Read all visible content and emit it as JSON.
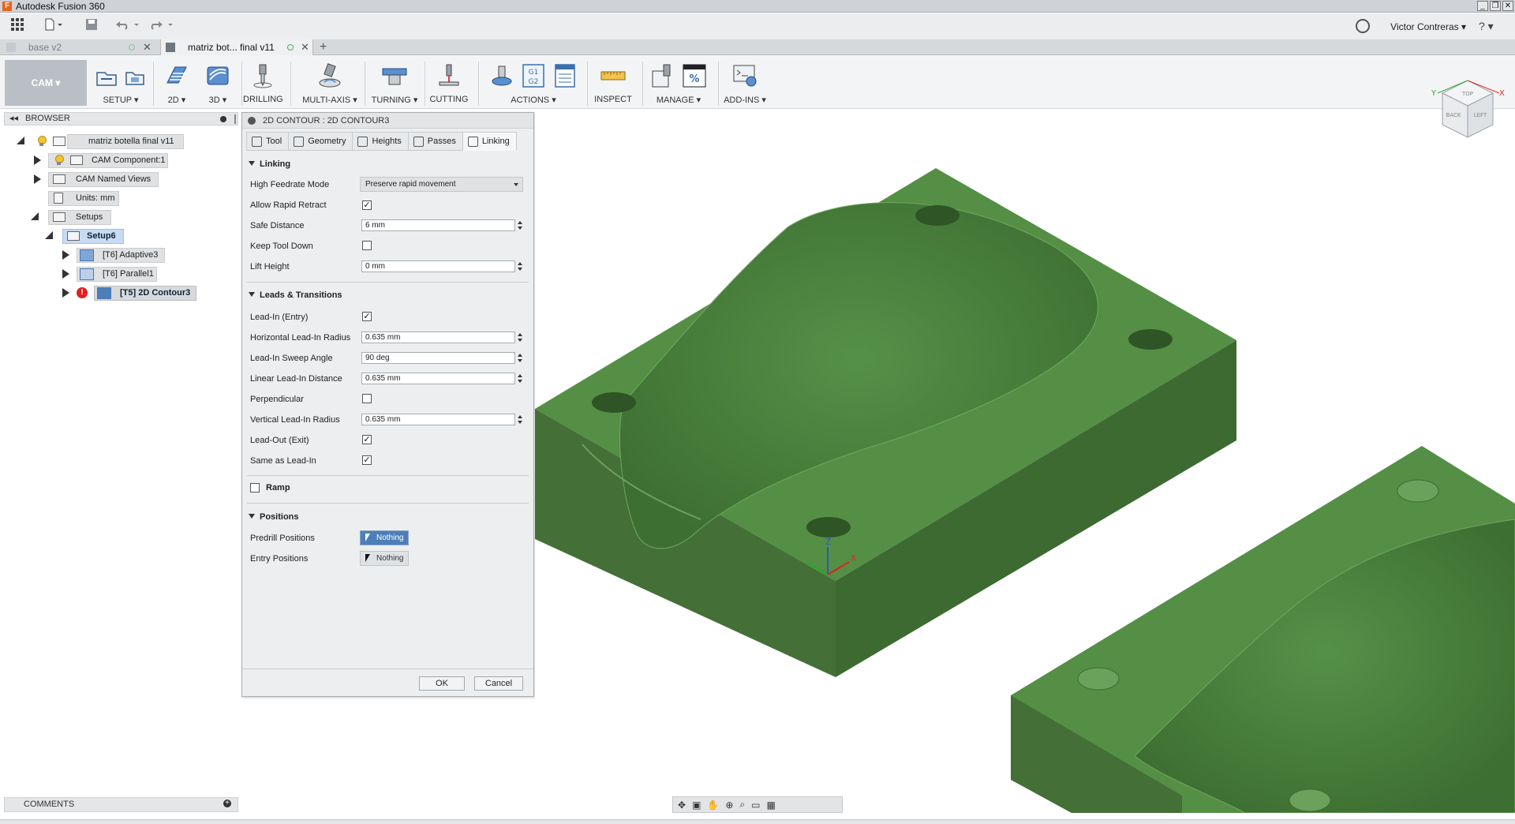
{
  "window": {
    "title": "Autodesk Fusion 360",
    "app_icon": "F"
  },
  "quick_access": {
    "user": "Victor Contreras ▾",
    "help": "? ▾"
  },
  "doc_tabs": [
    {
      "label": "base v2"
    },
    {
      "label": "matriz bot... final v11"
    }
  ],
  "ribbon": {
    "workspace": "CAM ▾",
    "groups": [
      {
        "label": "SETUP ▾"
      },
      {
        "label": "2D ▾"
      },
      {
        "label": "3D ▾"
      },
      {
        "label": "DRILLING"
      },
      {
        "label": "MULTI-AXIS ▾"
      },
      {
        "label": "TURNING ▾"
      },
      {
        "label": "CUTTING"
      },
      {
        "label": "ACTIONS ▾"
      },
      {
        "label": "INSPECT"
      },
      {
        "label": "MANAGE ▾"
      },
      {
        "label": "ADD-INS ▾"
      }
    ],
    "actions_icon_text": "G1\nG2",
    "manage_icon_text": "%"
  },
  "browser": {
    "title": "BROWSER",
    "collapse_glyph": "◂◂",
    "nodes": [
      {
        "label": "matriz botella final v11"
      },
      {
        "label": "CAM Component:1"
      },
      {
        "label": "CAM Named Views"
      },
      {
        "label": "Units: mm"
      },
      {
        "label": "Setups"
      },
      {
        "label": "Setup6"
      },
      {
        "label": "[T6] Adaptive3"
      },
      {
        "label": "[T6] Parallel1"
      },
      {
        "label": "[T5] 2D Contour3"
      }
    ],
    "warning_glyph": "!"
  },
  "comments": {
    "title": "COMMENTS",
    "plus": "+"
  },
  "dialog": {
    "title": "2D CONTOUR : 2D CONTOUR3",
    "tabs": [
      {
        "label": "Tool"
      },
      {
        "label": "Geometry"
      },
      {
        "label": "Heights"
      },
      {
        "label": "Passes"
      },
      {
        "label": "Linking"
      }
    ],
    "sections": {
      "linking": "Linking",
      "leads": "Leads & Transitions",
      "ramp": "Ramp",
      "positions": "Positions"
    },
    "rows": {
      "high_feedrate_mode": {
        "label": "High Feedrate Mode",
        "value": "Preserve rapid movement"
      },
      "allow_rapid_retract": {
        "label": "Allow Rapid Retract",
        "checked": true
      },
      "safe_distance": {
        "label": "Safe Distance",
        "value": "6 mm"
      },
      "keep_tool_down": {
        "label": "Keep Tool Down",
        "checked": false
      },
      "lift_height": {
        "label": "Lift Height",
        "value": "0 mm"
      },
      "lead_in": {
        "label": "Lead-In (Entry)",
        "checked": true
      },
      "horizontal_lead_in_radius": {
        "label": "Horizontal Lead-In Radius",
        "value": "0.635 mm"
      },
      "lead_in_sweep_angle": {
        "label": "Lead-In Sweep Angle",
        "value": "90 deg"
      },
      "linear_lead_in_distance": {
        "label": "Linear Lead-In Distance",
        "value": "0.635 mm"
      },
      "perpendicular": {
        "label": "Perpendicular",
        "checked": false
      },
      "vertical_lead_in_radius": {
        "label": "Vertical Lead-In Radius",
        "value": "0.635 mm"
      },
      "lead_out": {
        "label": "Lead-Out (Exit)",
        "checked": true
      },
      "same_as_lead_in": {
        "label": "Same as Lead-In",
        "checked": true
      },
      "ramp": {
        "checked": false
      },
      "predrill_positions": {
        "label": "Predrill Positions",
        "value": "Nothing"
      },
      "entry_positions": {
        "label": "Entry Positions",
        "value": "Nothing"
      }
    },
    "check_glyph": "✓",
    "ok": "OK",
    "cancel": "Cancel"
  },
  "viewcube": {
    "back": "BACK",
    "left": "LEFT",
    "top": "TOP",
    "x": "X",
    "y": "Y"
  },
  "triad": {
    "z": "Z",
    "x": "X"
  },
  "colors": {
    "part_green": "#4f8a3f",
    "accent_blue": "#4c7fb8",
    "warning_red": "#e02020"
  }
}
